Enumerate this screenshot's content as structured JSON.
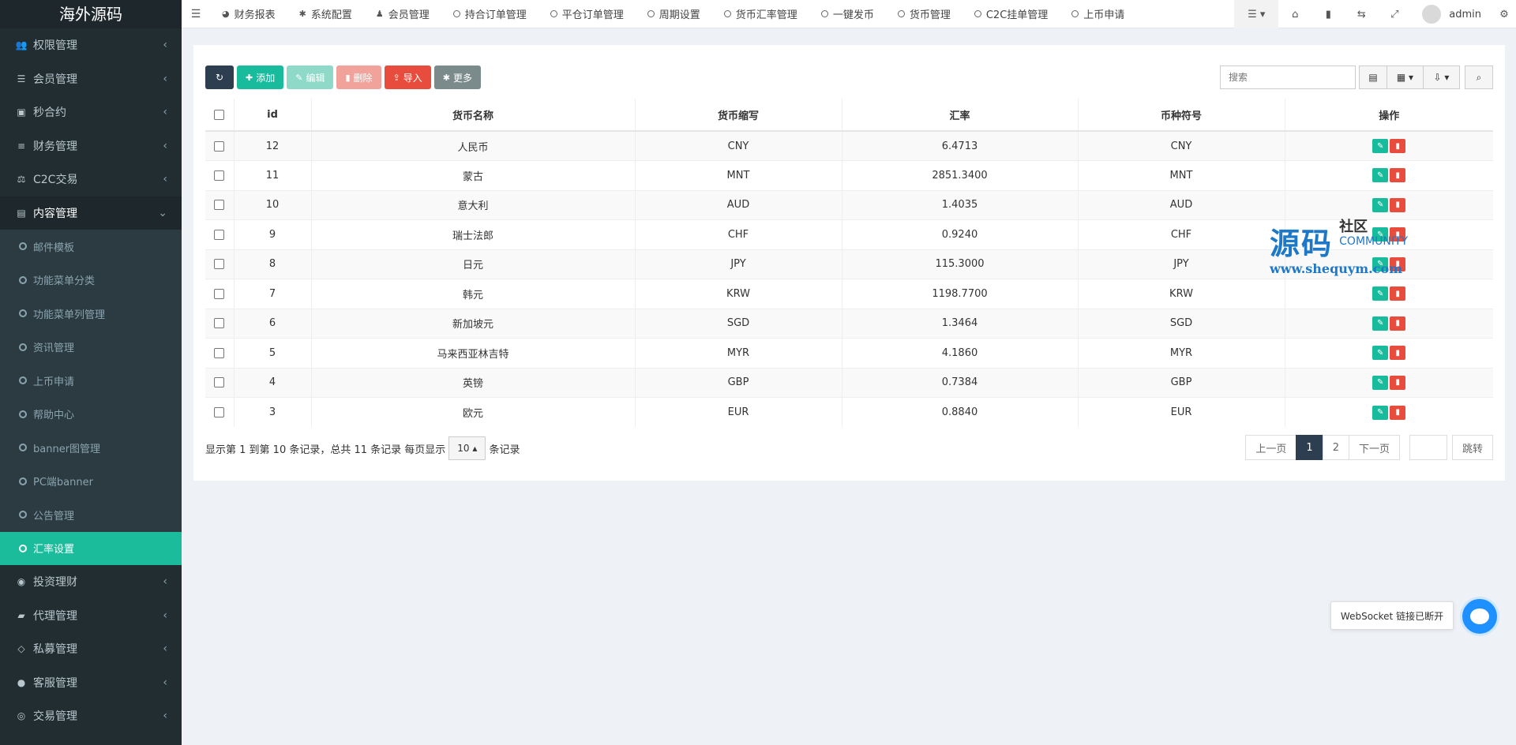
{
  "app": {
    "logo_text": "海外源码"
  },
  "sidebar": {
    "items_top": [
      {
        "label": "权限管理",
        "icon": "users-icon",
        "glyph": "👥"
      },
      {
        "label": "会员管理",
        "icon": "list-icon",
        "glyph": "☰"
      },
      {
        "label": "秒合约",
        "icon": "calendar-icon",
        "glyph": "▣"
      },
      {
        "label": "财务管理",
        "icon": "database-icon",
        "glyph": "≡"
      },
      {
        "label": "C2C交易",
        "icon": "balance-scale-icon",
        "glyph": "⚖"
      }
    ],
    "open_item": {
      "label": "内容管理",
      "icon": "file-text-icon",
      "glyph": "▤"
    },
    "subitems": [
      "邮件模板",
      "功能菜单分类",
      "功能菜单列管理",
      "资讯管理",
      "上币申请",
      "帮助中心",
      "banner图管理",
      "PC端banner",
      "公告管理",
      "汇率设置"
    ],
    "active_subitem": "汇率设置",
    "items_bottom": [
      {
        "label": "投资理财",
        "icon": "compass-icon",
        "glyph": "◉"
      },
      {
        "label": "代理管理",
        "icon": "briefcase-icon",
        "glyph": "▰"
      },
      {
        "label": "私募管理",
        "icon": "diamond-icon",
        "glyph": "◇"
      },
      {
        "label": "客服管理",
        "icon": "comment-icon",
        "glyph": "●"
      },
      {
        "label": "交易管理",
        "icon": "eye-icon",
        "glyph": "◎"
      }
    ]
  },
  "topbar": {
    "tabs": [
      {
        "label": "财务报表",
        "icon": "dashboard-icon",
        "glyph": "◕"
      },
      {
        "label": "系统配置",
        "icon": "cog-icon",
        "glyph": "✱"
      },
      {
        "label": "会员管理",
        "icon": "user-icon",
        "glyph": "♟"
      },
      {
        "label": "持合订单管理",
        "icon": "circle-icon"
      },
      {
        "label": "平仓订单管理",
        "icon": "circle-icon"
      },
      {
        "label": "周期设置",
        "icon": "circle-icon"
      },
      {
        "label": "货币汇率管理",
        "icon": "circle-icon"
      },
      {
        "label": "一键发币",
        "icon": "circle-icon"
      },
      {
        "label": "货币管理",
        "icon": "circle-icon"
      },
      {
        "label": "C2C挂单管理",
        "icon": "circle-icon"
      },
      {
        "label": "上币申请",
        "icon": "circle-icon"
      }
    ],
    "user_name": "admin"
  },
  "toolbar": {
    "refresh_label": "",
    "add_label": "添加",
    "edit_label": "编辑",
    "delete_label": "删除",
    "import_label": "导入",
    "more_label": "更多",
    "search_placeholder": "搜索"
  },
  "table": {
    "columns": [
      "id",
      "货币名称",
      "货币缩写",
      "汇率",
      "币种符号",
      "操作"
    ],
    "rows": [
      {
        "id": "12",
        "name": "人民币",
        "abbr": "CNY",
        "rate": "6.4713",
        "symbol": "CNY"
      },
      {
        "id": "11",
        "name": "蒙古",
        "abbr": "MNT",
        "rate": "2851.3400",
        "symbol": "MNT"
      },
      {
        "id": "10",
        "name": "意大利",
        "abbr": "AUD",
        "rate": "1.4035",
        "symbol": "AUD"
      },
      {
        "id": "9",
        "name": "瑞士法郎",
        "abbr": "CHF",
        "rate": "0.9240",
        "symbol": "CHF"
      },
      {
        "id": "8",
        "name": "日元",
        "abbr": "JPY",
        "rate": "115.3000",
        "symbol": "JPY"
      },
      {
        "id": "7",
        "name": "韩元",
        "abbr": "KRW",
        "rate": "1198.7700",
        "symbol": "KRW"
      },
      {
        "id": "6",
        "name": "新加坡元",
        "abbr": "SGD",
        "rate": "1.3464",
        "symbol": "SGD"
      },
      {
        "id": "5",
        "name": "马来西亚林吉特",
        "abbr": "MYR",
        "rate": "4.1860",
        "symbol": "MYR"
      },
      {
        "id": "4",
        "name": "英镑",
        "abbr": "GBP",
        "rate": "0.7384",
        "symbol": "GBP"
      },
      {
        "id": "3",
        "name": "欧元",
        "abbr": "EUR",
        "rate": "0.8840",
        "symbol": "EUR"
      }
    ]
  },
  "footer": {
    "info_text": "显示第 1 到第 10 条记录，总共 11 条记录 每页显示",
    "page_size": "10",
    "suffix": "条记录",
    "prev_label": "上一页",
    "pages": [
      "1",
      "2"
    ],
    "current_page": "1",
    "next_label": "下一页",
    "jump_label": "跳转"
  },
  "watermark": {
    "main": "源码",
    "cn": "社区",
    "en": "COMMUNITY",
    "url": "www.shequym.com"
  },
  "toast": {
    "text": "WebSocket 链接已断开"
  },
  "colors": {
    "accent": "#18bc9c",
    "sidebar_bg": "#222d32",
    "danger": "#e74c3c",
    "dark": "#2c3e50"
  }
}
